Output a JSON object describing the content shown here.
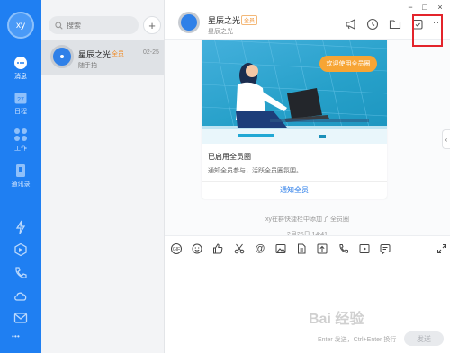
{
  "rail": {
    "avatar_text": "xy",
    "nav": [
      {
        "label": "消息",
        "icon": "chat-bubble-icon"
      },
      {
        "label": "日程",
        "icon": "calendar-icon",
        "day": "27"
      },
      {
        "label": "工作",
        "icon": "grid-apps-icon"
      },
      {
        "label": "通讯录",
        "icon": "contacts-icon"
      }
    ],
    "bottom_icons": [
      "lightning-icon",
      "cube-icon",
      "phone-icon",
      "cloud-icon",
      "mail-icon",
      "more-icon"
    ],
    "more_label": "• • •"
  },
  "list": {
    "search_placeholder": "搜索",
    "add_label": "+",
    "conversation": {
      "name": "星辰之光",
      "tag": "全员",
      "time": "02-25",
      "preview": "随手拍"
    }
  },
  "chat": {
    "title": "星辰之光",
    "title_tag": "全员",
    "subtitle": "星辰之光",
    "header_icons": [
      "megaphone-icon",
      "clock-icon",
      "folder-icon",
      "calendar-add-icon",
      "more-icon"
    ],
    "more_label": "···",
    "card": {
      "banner_text": "欢迎使用全员圈",
      "title": "已启用全员圈",
      "description": "通知全员参与，活跃全员圈氛围。",
      "link": "通知全员"
    },
    "system_message": "xy在群快捷栏中添加了 全员圈",
    "date_message": "2月25日 14:41",
    "toolbar_icons": [
      "gif-icon",
      "emoji-icon",
      "thumbs-up-icon",
      "scissors-icon",
      "at-icon",
      "image-icon",
      "file-icon",
      "upload-icon",
      "call-icon",
      "video-icon",
      "chat-record-icon"
    ],
    "gif_label": "GIF",
    "at_label": "@",
    "send_hint": "Enter 发送，Ctrl+Enter 换行",
    "send_label": "发送",
    "collapse_label": "‹",
    "watermark": "Bai 经验"
  },
  "window": {
    "minimize": "−",
    "maximize": "□",
    "close": "×"
  },
  "colors": {
    "rail": "#1f7ff2",
    "accent": "#2b7de9",
    "tag": "#f08a24",
    "highlight_box": "#e3242b",
    "banner_bubble": "#f7a534"
  }
}
